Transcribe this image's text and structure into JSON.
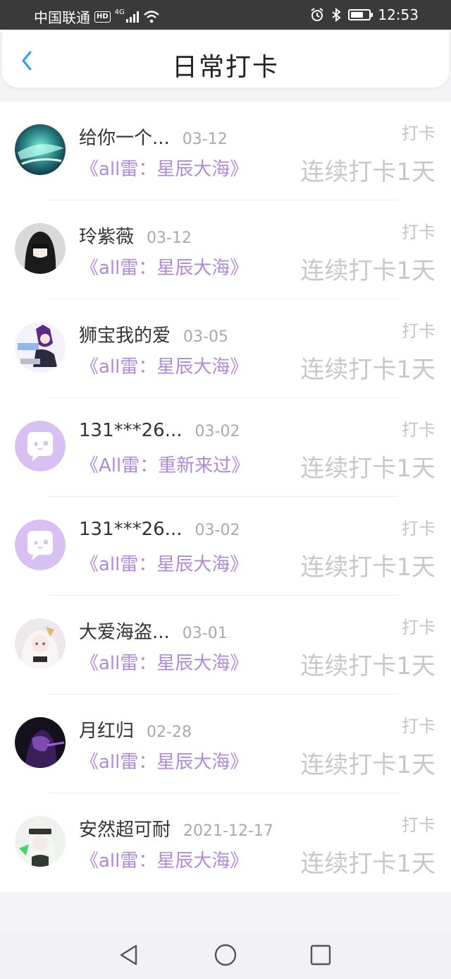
{
  "status_bar": {
    "carrier": "中国联通",
    "hd": "HD",
    "network": "4G",
    "time": "12:53",
    "battery_level": 0.7
  },
  "header": {
    "title": "日常打卡",
    "back_icon": "chevron-left-icon",
    "accent": "#2a9df4"
  },
  "colors": {
    "book": "#b08ad8",
    "placeholder_avatar": "#d7c0f2"
  },
  "checkins": [
    {
      "name": "给你一个...",
      "date": "03-12",
      "book": "《all雷：星辰大海》",
      "tag": "打卡",
      "streak": "连续打卡1天",
      "avatar": "teal-abstract"
    },
    {
      "name": "玲紫薇",
      "date": "03-12",
      "book": "《all雷：星辰大海》",
      "tag": "打卡",
      "streak": "连续打卡1天",
      "avatar": "dark-portrait"
    },
    {
      "name": "狮宝我的爱",
      "date": "03-05",
      "book": "《all雷：星辰大海》",
      "tag": "打卡",
      "streak": "连续打卡1天",
      "avatar": "anime-purple"
    },
    {
      "name": "131***26...",
      "date": "03-02",
      "book": "《All雷：重新来过》",
      "tag": "打卡",
      "streak": "连续打卡1天",
      "avatar": "default-chat"
    },
    {
      "name": "131***26...",
      "date": "03-02",
      "book": "《all雷：星辰大海》",
      "tag": "打卡",
      "streak": "连续打卡1天",
      "avatar": "default-chat"
    },
    {
      "name": "大爱海盗...",
      "date": "03-01",
      "book": "《all雷：星辰大海》",
      "tag": "打卡",
      "streak": "连续打卡1天",
      "avatar": "anime-white"
    },
    {
      "name": "月红归",
      "date": "02-28",
      "book": "《all雷：星辰大海》",
      "tag": "打卡",
      "streak": "连续打卡1天",
      "avatar": "dark-violet"
    },
    {
      "name": "安然超可耐",
      "date": "2021-12-17",
      "book": "《all雷：星辰大海》",
      "tag": "打卡",
      "streak": "连续打卡1天",
      "avatar": "anime-green"
    }
  ],
  "nav": {
    "back": "triangle-back-icon",
    "home": "circle-home-icon",
    "recent": "square-recent-icon"
  }
}
